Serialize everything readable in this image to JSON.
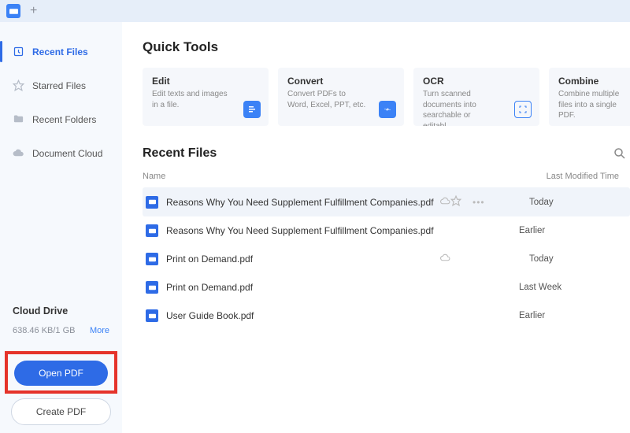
{
  "titlebar": {
    "app_icon": "pdf-app",
    "new_tab": "+"
  },
  "sidebar": {
    "items": [
      {
        "label": "Recent Files",
        "icon": "clock-icon",
        "active": true
      },
      {
        "label": "Starred Files",
        "icon": "star-icon",
        "active": false
      },
      {
        "label": "Recent Folders",
        "icon": "folder-icon",
        "active": false
      },
      {
        "label": "Document Cloud",
        "icon": "cloud-icon",
        "active": false
      }
    ],
    "cloud": {
      "title": "Cloud Drive",
      "usage": "638.46 KB/1 GB",
      "more": "More"
    },
    "open_btn": "Open PDF",
    "create_btn": "Create PDF"
  },
  "main": {
    "quick_tools_heading": "Quick Tools",
    "tools": [
      {
        "title": "Edit",
        "desc": "Edit texts and images in a file.",
        "icon": "edit-icon",
        "color": "#3b82f6"
      },
      {
        "title": "Convert",
        "desc": "Convert PDFs to Word, Excel, PPT, etc.",
        "icon": "convert-icon",
        "color": "#3b82f6"
      },
      {
        "title": "OCR",
        "desc": "Turn scanned documents into searchable or editabl...",
        "icon": "ocr-icon",
        "color": "#3b82f6"
      },
      {
        "title": "Combine",
        "desc": "Combine multiple files into a single PDF.",
        "icon": "combine-icon",
        "color": "#3b82f6"
      }
    ],
    "recent_heading": "Recent Files",
    "columns": {
      "name": "Name",
      "time": "Last Modified Time"
    },
    "files": [
      {
        "name": "Reasons Why You Need Supplement Fulfillment Companies.pdf",
        "time": "Today",
        "cloud": true,
        "hover": true
      },
      {
        "name": "Reasons Why You Need Supplement Fulfillment Companies.pdf",
        "time": "Earlier",
        "cloud": false,
        "hover": false
      },
      {
        "name": "Print on Demand.pdf",
        "time": "Today",
        "cloud": true,
        "hover": false
      },
      {
        "name": "Print on Demand.pdf",
        "time": "Last Week",
        "cloud": false,
        "hover": false
      },
      {
        "name": "User Guide Book.pdf",
        "time": "Earlier",
        "cloud": false,
        "hover": false
      }
    ]
  }
}
